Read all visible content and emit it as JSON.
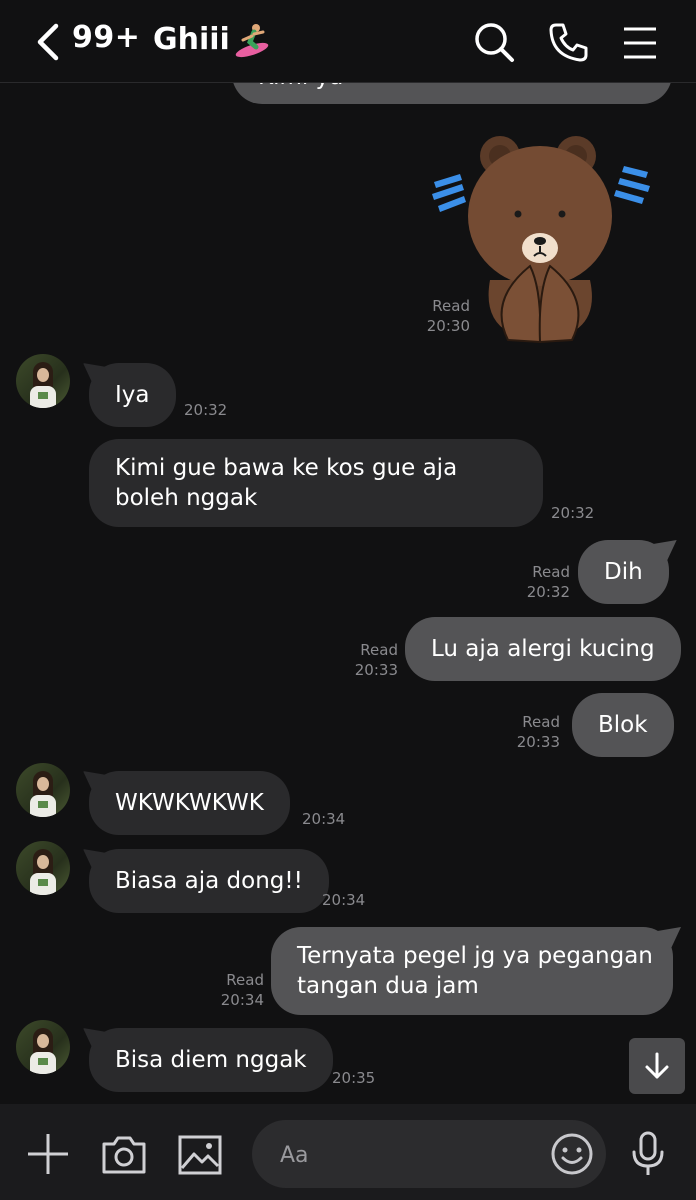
{
  "header": {
    "unread_count": "99+",
    "chat_title": "Ghiii",
    "title_emoji": "surfer-emoji"
  },
  "partial_message": {
    "text": "Kimi ya"
  },
  "messages": [
    {
      "side": "out",
      "type": "sticker",
      "sticker": "brown-bear-pleading-sticker",
      "read": "Read",
      "time": "20:30"
    },
    {
      "side": "in",
      "text": "Iya",
      "time": "20:32"
    },
    {
      "side": "in",
      "text": "Kimi gue bawa ke kos gue aja boleh nggak",
      "time": "20:32"
    },
    {
      "side": "out",
      "text": "Dih",
      "read": "Read",
      "time": "20:32"
    },
    {
      "side": "out",
      "text": "Lu aja alergi kucing",
      "read": "Read",
      "time": "20:33"
    },
    {
      "side": "out",
      "text": "Blok",
      "read": "Read",
      "time": "20:33"
    },
    {
      "side": "in",
      "text": "WKWKWKWK",
      "time": "20:34"
    },
    {
      "side": "in",
      "text": "Biasa aja dong!!",
      "time": "20:34"
    },
    {
      "side": "out",
      "text": "Ternyata pegel jg ya pegangan tangan dua jam",
      "read": "Read",
      "time": "20:34"
    },
    {
      "side": "in",
      "text": "Bisa diem nggak",
      "time": "20:35"
    }
  ],
  "composer": {
    "placeholder": "Aa"
  },
  "icons": {
    "back": "chevron-left-icon",
    "search": "search-icon",
    "call": "phone-icon",
    "menu": "menu-icon",
    "add": "plus-icon",
    "camera": "camera-icon",
    "gallery": "image-icon",
    "emoji": "smiley-icon",
    "voice": "microphone-icon",
    "scroll": "arrow-down-icon"
  },
  "colors": {
    "background": "#111112",
    "incoming_bubble": "#2a2a2c",
    "outgoing_bubble": "#545456",
    "meta_text": "#8a8a8e"
  }
}
